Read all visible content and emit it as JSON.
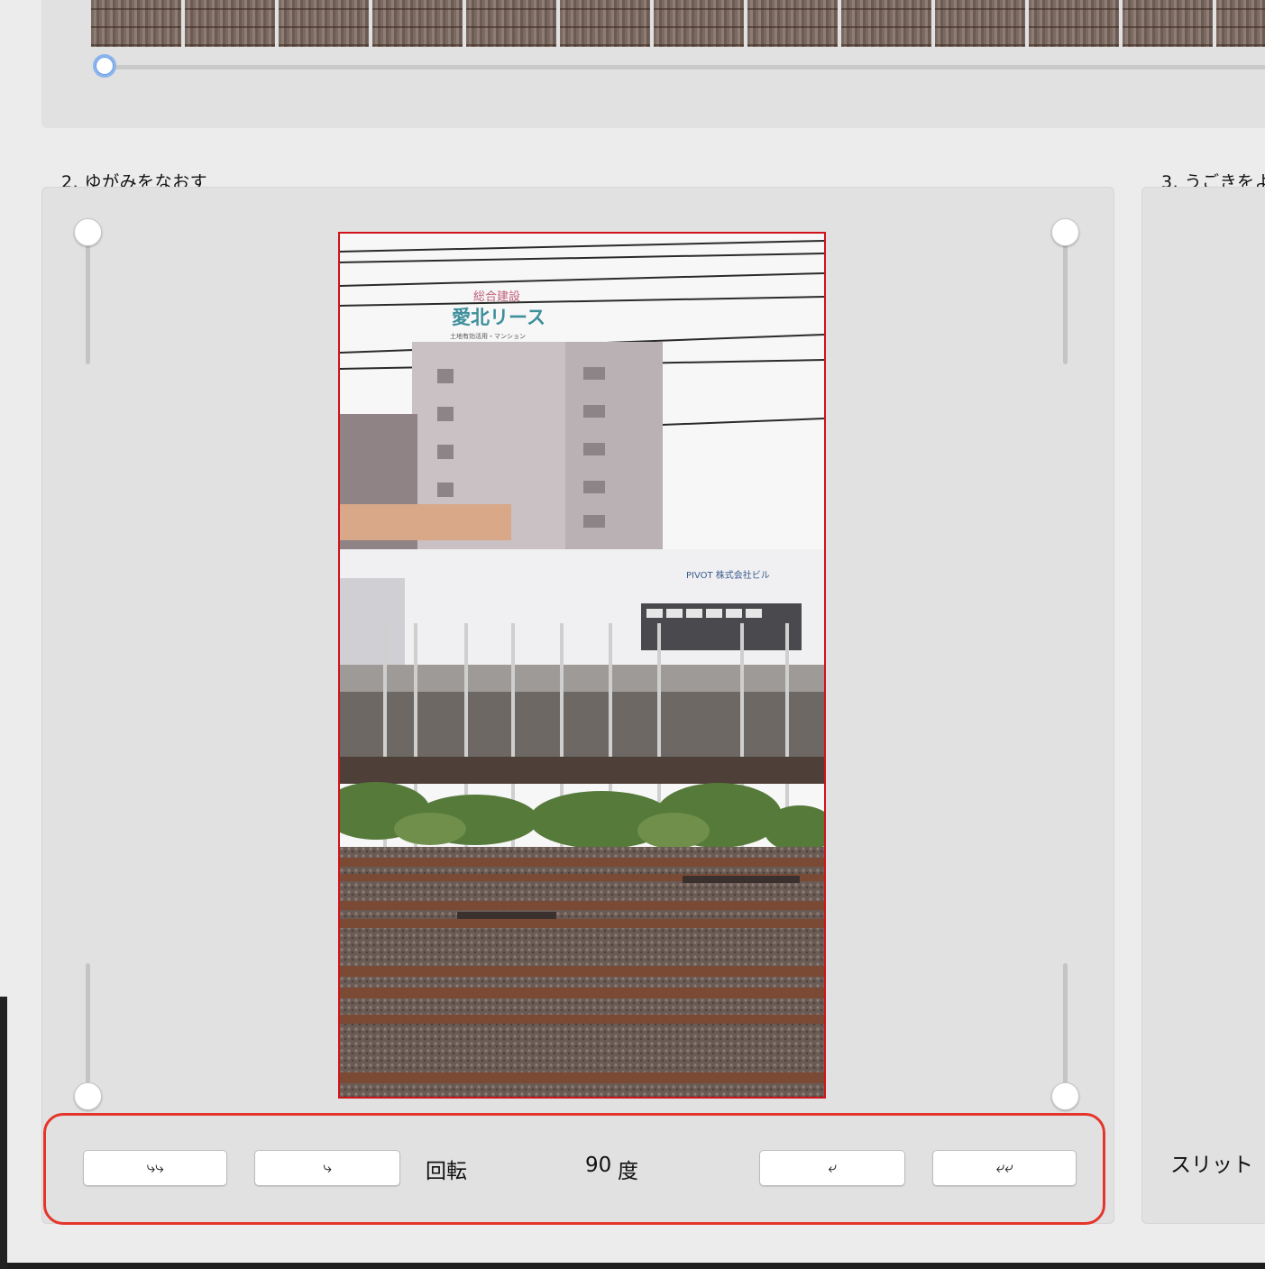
{
  "section2": {
    "label": "2. ゆがみをなおす"
  },
  "section3": {
    "label": "3. うごきをよ"
  },
  "rotation": {
    "left_double": "⤷⤷",
    "left_single": "⤷",
    "label": "回転",
    "value": "90",
    "unit": "度",
    "right_single": "⤶",
    "right_double": "⤶⤶"
  },
  "section3_control": {
    "label": "スリット"
  },
  "photo": {
    "sign_top": "総合建設",
    "sign_main": "愛北リース",
    "sign_sub": "土地有効活用・マンション",
    "sign_building": "PIVOT 株式会社ビル"
  },
  "timeline": {
    "position": 0
  },
  "colors": {
    "highlight": "#e5352b",
    "preview_border": "#d0121a",
    "panel": "#e1e1e1",
    "knob_focus": "#8ab4ee"
  }
}
